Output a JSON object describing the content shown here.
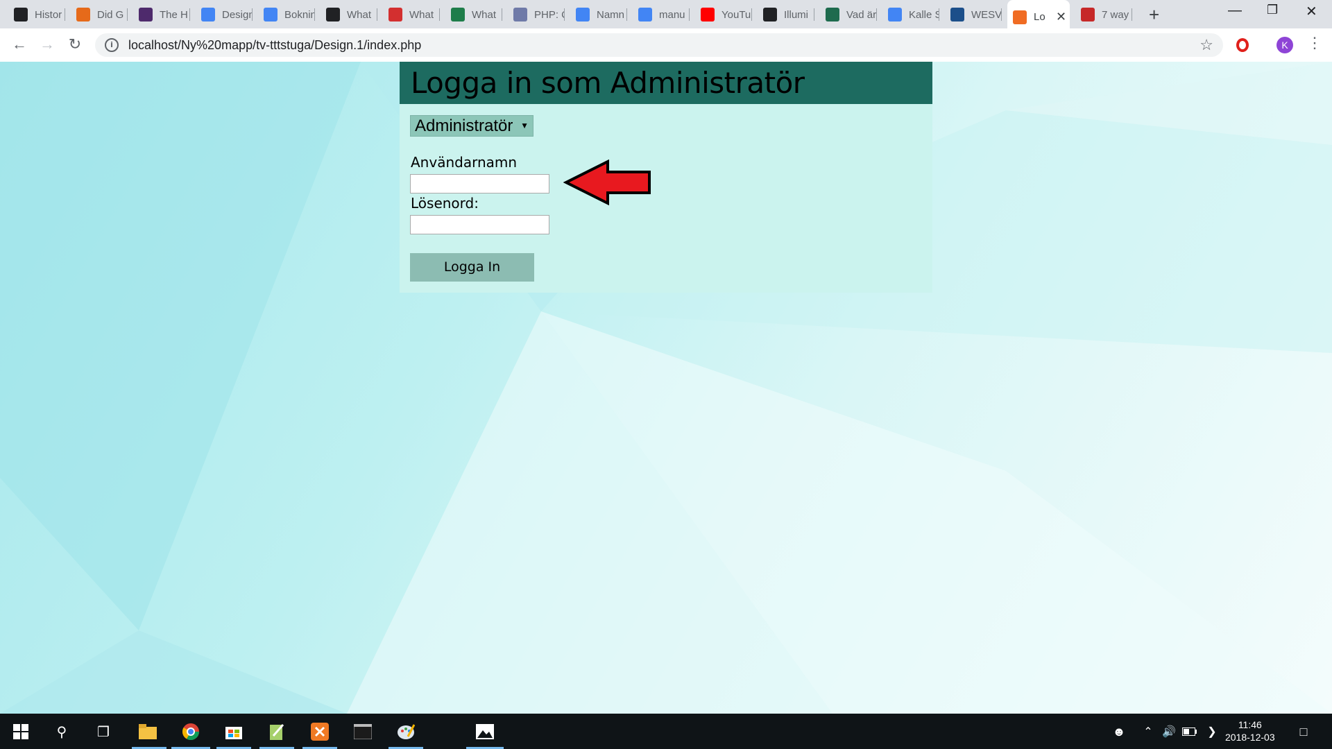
{
  "browser": {
    "tabs": [
      {
        "title": "Histor",
        "favicon": "wikipedia-icon",
        "color": "#202124"
      },
      {
        "title": "Did G",
        "favicon": "framed-e-icon",
        "color": "#e66a1a"
      },
      {
        "title": "The H",
        "favicon": "w-logo-icon",
        "color": "#4e2a6c"
      },
      {
        "title": "Design",
        "favicon": "docs-icon",
        "color": "#4285f4"
      },
      {
        "title": "Boknin",
        "favicon": "docs-icon",
        "color": "#4285f4"
      },
      {
        "title": "What",
        "favicon": "triangle-a-icon",
        "color": "#202124"
      },
      {
        "title": "What",
        "favicon": "red-bird-icon",
        "color": "#d32f2f"
      },
      {
        "title": "What",
        "favicon": "tl-logo-icon",
        "color": "#1e7d4a"
      },
      {
        "title": "PHP: C",
        "favicon": "php-icon",
        "color": "#6f7aa8"
      },
      {
        "title": "Namn",
        "favicon": "docs-icon",
        "color": "#4285f4"
      },
      {
        "title": "manu",
        "favicon": "docs-icon",
        "color": "#4285f4"
      },
      {
        "title": "YouTu",
        "favicon": "youtube-icon",
        "color": "#ff0000"
      },
      {
        "title": "Illumi",
        "favicon": "wikipedia-icon",
        "color": "#202124"
      },
      {
        "title": "Vad är",
        "favicon": "person-card-icon",
        "color": "#1e6b4e"
      },
      {
        "title": "Kalle S",
        "favicon": "docs-icon",
        "color": "#4285f4"
      },
      {
        "title": "WESV",
        "favicon": "person-card-icon",
        "color": "#1c4f8a"
      },
      {
        "title": "Lo",
        "favicon": "xampp-icon",
        "color": "#f06c23",
        "active": true
      },
      {
        "title": "7 way",
        "favicon": "red-c-icon",
        "color": "#c62828"
      }
    ],
    "url": "localhost/Ny%20mapp/tv-tttstuga/Design.1/index.php",
    "profile_initial": "K"
  },
  "page": {
    "header_title": "Logga in som Administratör",
    "role_select_value": "Administratör",
    "username_label": "Användarnamn",
    "password_label": "Lösenord:",
    "username_value": "",
    "password_value": "",
    "login_button": "Logga In"
  },
  "taskbar": {
    "time": "11:46",
    "date": "2018-12-03"
  },
  "colors": {
    "header_bg": "#1d6b60",
    "panel_bg": "#cbf3ee",
    "arrow": "#e8191f"
  }
}
